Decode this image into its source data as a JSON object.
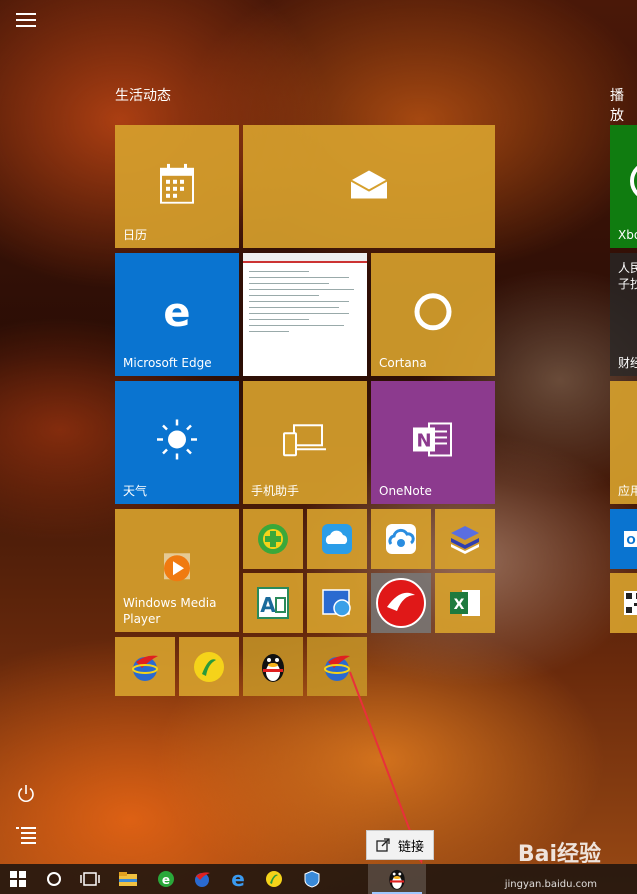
{
  "start_menu": {
    "group_title": "生活动态",
    "group_title_2": "播放"
  },
  "tiles": {
    "calendar": "日历",
    "mail": "",
    "edge": "Microsoft Edge",
    "cortana": "Cortana",
    "weather": "天气",
    "phone_helper": "手机助手",
    "onenote": "OneNote",
    "wmp_line1": "Windows Media",
    "wmp_line2": "Player"
  },
  "right_partial": {
    "xbox": "Xbo",
    "news_1": "人民",
    "news_2": "子抄",
    "finance": "财经",
    "apps": "应用"
  },
  "tooltip": {
    "text": "链接"
  },
  "watermark": {
    "brand": "Bai经验",
    "url": "jingyan.baidu.com"
  },
  "colors": {
    "tile_gold": "#d6a02d",
    "tile_blue": "#0a74d0",
    "tile_purple": "#8c3a8e",
    "xbox_green": "#107c10",
    "arrow_red": "#e8303a"
  }
}
